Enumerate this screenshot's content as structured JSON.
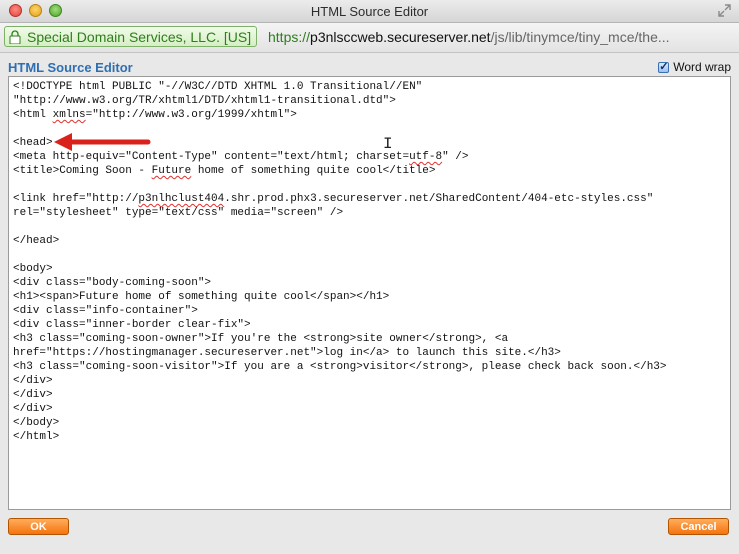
{
  "window": {
    "title": "HTML Source Editor"
  },
  "urlbar": {
    "ssl_identity": "Special Domain Services, LLC. [US]",
    "scheme": "https://",
    "host": "p3nlsccweb.secureserver.net",
    "path": "/js/lib/tinymce/tiny_mce/the..."
  },
  "dialog": {
    "header": "HTML Source Editor",
    "word_wrap_label": "Word wrap",
    "word_wrap_checked": true,
    "source_lines": [
      "<!DOCTYPE html PUBLIC \"-//W3C//DTD XHTML 1.0 Transitional//EN\"",
      "\"http://www.w3.org/TR/xhtml1/DTD/xhtml1-transitional.dtd\">",
      "<html xmlns=\"http://www.w3.org/1999/xhtml\">",
      "",
      "<head>",
      "<meta http-equiv=\"Content-Type\" content=\"text/html; charset=utf-8\" />",
      "<title>Coming Soon - Future home of something quite cool</title>",
      "",
      "<link href=\"http://p3nlhclust404.shr.prod.phx3.secureserver.net/SharedContent/404-etc-styles.css\"",
      "rel=\"stylesheet\" type=\"text/css\" media=\"screen\" />",
      "",
      "</head>",
      "",
      "<body>",
      "<div class=\"body-coming-soon\">",
      "<h1><span>Future home of something quite cool</span></h1>",
      "<div class=\"info-container\">",
      "<div class=\"inner-border clear-fix\">",
      "<h3 class=\"coming-soon-owner\">If you're the <strong>site owner</strong>, <a",
      "href=\"https://hostingmanager.secureserver.net\">log in</a> to launch this site.</h3>",
      "<h3 class=\"coming-soon-visitor\">If you are a <strong>visitor</strong>, please check back soon.</h3>",
      "</div>",
      "</div>",
      "</div>",
      "</body>",
      "</html>"
    ],
    "ok_label": "OK",
    "cancel_label": "Cancel"
  },
  "colors": {
    "accent": "#f5730d",
    "header_blue": "#2e6fb2",
    "arrow": "#d9221b",
    "ssl_green": "#2f7d1e"
  }
}
